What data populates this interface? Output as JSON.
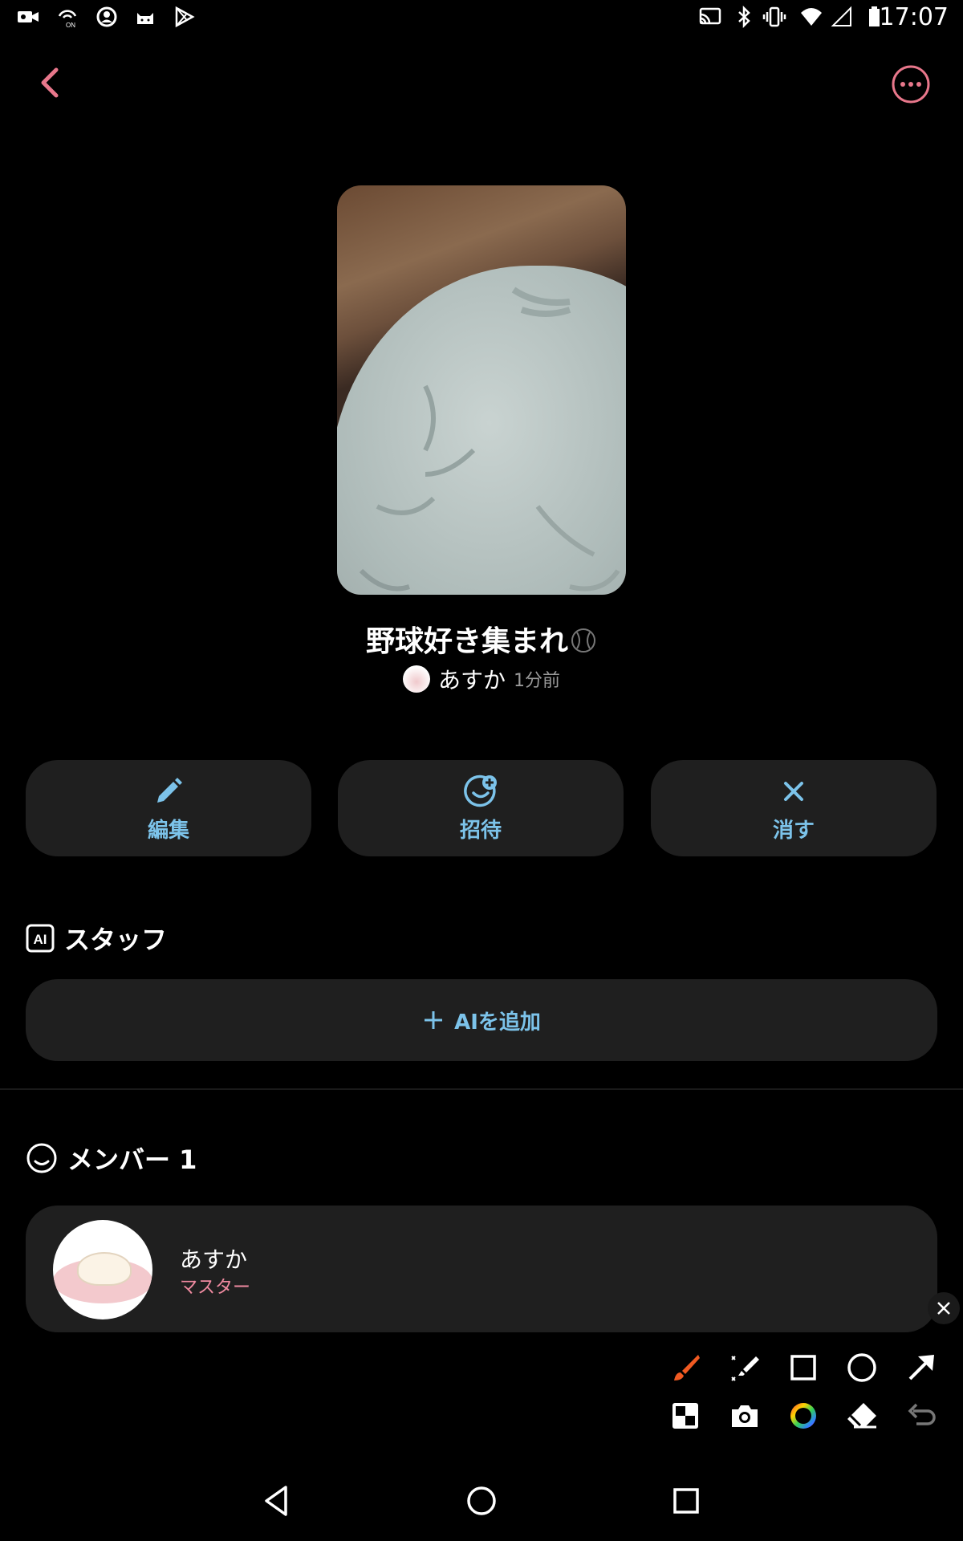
{
  "status_bar": {
    "time": "17:07",
    "left_icons": [
      "video-camera-icon",
      "hotspot-on-icon",
      "person-sync-icon",
      "cat-icon",
      "play-store-icon"
    ],
    "right_icons": [
      "cast-icon",
      "bluetooth-icon",
      "vibrate-icon",
      "wifi-icon",
      "signal-icon",
      "battery-icon"
    ]
  },
  "header": {
    "back_icon": "chevron-left-icon",
    "more_icon": "more-horizontal-icon",
    "accent_color": "#e8778b"
  },
  "room": {
    "title": "野球好き集まれ",
    "title_emoji": "baseball-icon",
    "author": "あすか",
    "posted": "1分前"
  },
  "actions": [
    {
      "label": "編集",
      "icon": "pencil-icon"
    },
    {
      "label": "招待",
      "icon": "add-person-icon"
    },
    {
      "label": "消す",
      "icon": "close-icon"
    }
  ],
  "staff": {
    "title": "スタッフ",
    "icon": "ai-badge-icon",
    "icon_text": "AI",
    "add_label": "AIを追加"
  },
  "members": {
    "title": "メンバー",
    "count": "1",
    "items": [
      {
        "name": "あすか",
        "role": "マスター"
      }
    ]
  },
  "toolbar": {
    "row1": [
      "brush-icon",
      "highlighter-icon",
      "rectangle-icon",
      "circle-icon",
      "arrow-icon"
    ],
    "row2": [
      "mosaic-icon",
      "camera-icon",
      "color-wheel-icon",
      "eraser-icon",
      "undo-icon"
    ],
    "brush_color": "#f05a22"
  },
  "nav_bar": [
    "back-triangle-icon",
    "home-circle-icon",
    "recents-square-icon"
  ],
  "colors": {
    "accent_blue": "#7cc3ea",
    "card_bg": "#1f1f1f",
    "role_pink": "#ef8aa0"
  }
}
